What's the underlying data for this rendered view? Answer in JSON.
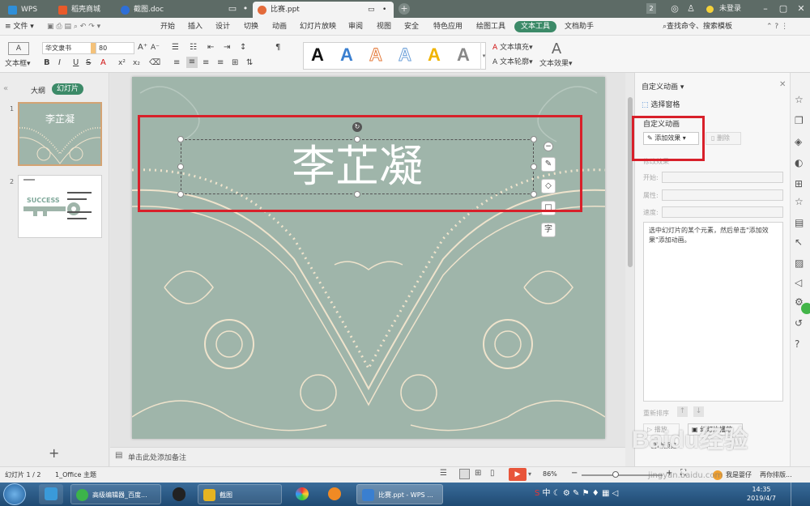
{
  "titlebar": {
    "tabs": [
      {
        "label": "WPS",
        "color": "#2f8fd8"
      },
      {
        "label": "稻壳商城",
        "color": "#e85a2a"
      },
      {
        "label": "截图.doc",
        "color": "#2f6fd8"
      },
      {
        "label": "比赛.ppt",
        "color": "#e36a3a"
      }
    ],
    "badge": "2",
    "login": "未登录"
  },
  "menu": {
    "file": "文件",
    "items": [
      "开始",
      "插入",
      "设计",
      "切换",
      "动画",
      "幻灯片放映",
      "审阅",
      "视图",
      "安全",
      "特色应用",
      "绘图工具",
      "文本工具",
      "文档助手"
    ],
    "active": "文本工具",
    "search": "查找命令、搜索模板"
  },
  "ribbon": {
    "textbox": "文本框",
    "font_name": "华文隶书",
    "font_size": "80",
    "text_fill": "文本填充",
    "text_outline": "文本轮廓",
    "text_effect": "文本效果",
    "style_letter": "A",
    "style_colors": [
      "#111111",
      "#3a7fd0",
      "#e47a3a",
      "#6b9fd8",
      "#f0b400",
      "#888888"
    ]
  },
  "leftpane": {
    "tab_outline": "大纲",
    "tab_slides": "幻灯片",
    "slides": [
      {
        "num": "1",
        "title": "李芷凝"
      },
      {
        "num": "2",
        "title": "SUCCESS"
      }
    ]
  },
  "slide": {
    "title": "李芷凝",
    "side_tool_char": "字"
  },
  "notes": {
    "placeholder": "单击此处添加备注"
  },
  "panel": {
    "title": "自定义动画",
    "select_pane": "选择窗格",
    "section": "自定义动画",
    "add_effect": "添加效果",
    "delete": "删除",
    "modify": "修改效果",
    "start": "开始:",
    "property": "属性:",
    "speed": "速度:",
    "hint": "选中幻灯片的某个元素，然后单击\"添加效果\"添加动画。",
    "reorder": "重新排序",
    "play": "播放",
    "slideshow": "幻灯片播放",
    "autopreview": "自动预览"
  },
  "status": {
    "slide_info": "幻灯片 1 / 2",
    "theme": "1_Office 主题",
    "zoom": "86%",
    "user": "我是婴仔",
    "layout": "再你排版..."
  },
  "taskbar": {
    "tasks": [
      {
        "label": "高级编辑器_百度...",
        "color": "#3cb34a"
      },
      {
        "label": "截图",
        "color": "#e6b422"
      },
      {
        "label": "比赛.ppt - WPS ...",
        "color": "#3a7fd0"
      }
    ],
    "time": "14:35",
    "date": "2019/4/7"
  },
  "watermark": "Baidu经验",
  "watermark_url": "jingyan.baidu.com"
}
